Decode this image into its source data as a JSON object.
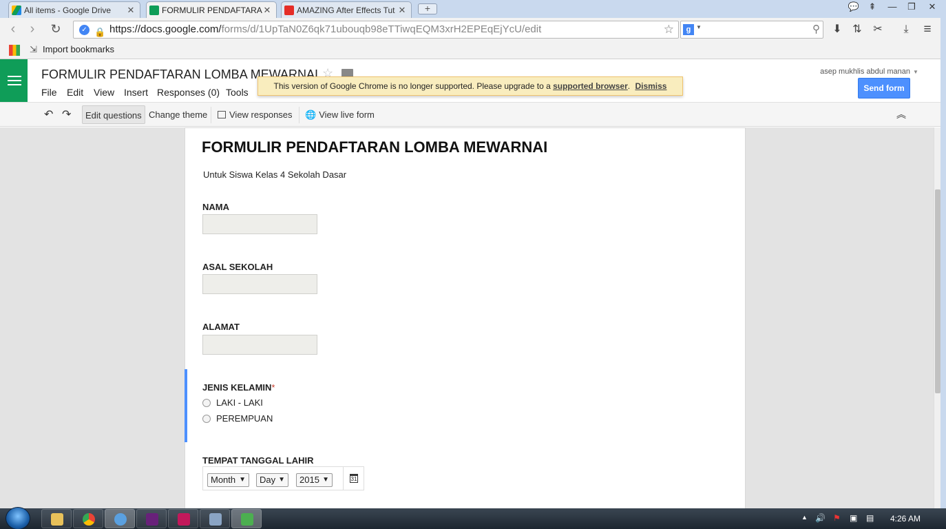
{
  "browser": {
    "tabs": [
      {
        "title": "All items - Google Drive",
        "icon": "google-drive-icon",
        "color": "#1e88e5"
      },
      {
        "title": "FORMULIR PENDAFTARA",
        "icon": "google-forms-icon",
        "color": "#0f9d58"
      },
      {
        "title": "AMAZING After Effects Tut",
        "icon": "youtube-icon",
        "color": "#e52d27"
      }
    ],
    "url_host": "https://docs.google.com/",
    "url_path": "forms/d/1UpTaN0Z6qk71ubouqb98eTTiwqEQM3xrH2EPEqEjYcU/edit",
    "bookmark": "Import bookmarks"
  },
  "app": {
    "doc_title": "FORMULIR PENDAFTARAN LOMBA MEWARNAI",
    "menus": [
      "File",
      "Edit",
      "View",
      "Insert",
      "Responses (0)",
      "Tools"
    ],
    "notice_text": "This version of Google Chrome is no longer supported. Please upgrade to a ",
    "notice_link": "supported browser",
    "notice_dismiss": "Dismiss",
    "user": "asep mukhlis abdul manan",
    "send_form": "Send form"
  },
  "toolbar": {
    "edit_questions": "Edit questions",
    "change_theme": "Change theme",
    "view_responses": "View responses",
    "view_live_form": "View live form"
  },
  "form": {
    "title": "FORMULIR PENDAFTARAN LOMBA MEWARNAI",
    "description": "Untuk Siswa Kelas 4 Sekolah Dasar",
    "q_nama": "NAMA",
    "q_asal": "ASAL SEKOLAH",
    "q_alamat": "ALAMAT",
    "q_jenis": "JENIS KELAMIN",
    "required_mark": "*",
    "options": [
      "LAKI - LAKI",
      "PEREMPUAN"
    ],
    "q_tempat": "TEMPAT TANGGAL LAHIR",
    "date_month": "Month",
    "date_day": "Day",
    "date_year": "2015",
    "calendar_day": "31"
  },
  "taskbar": {
    "clock": "4:26 AM"
  }
}
